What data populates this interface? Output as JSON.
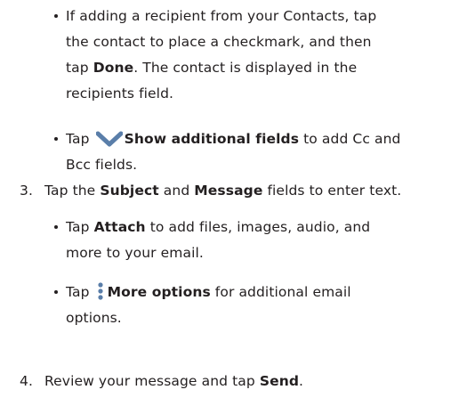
{
  "bullets_top": [
    {
      "parts": [
        {
          "t": "If adding a recipient from your Contacts, tap",
          "b": false,
          "br": true
        },
        {
          "t": "the contact to place a checkmark, and then",
          "b": false,
          "br": true
        },
        {
          "t": "tap ",
          "b": false
        },
        {
          "t": "Done",
          "b": true
        },
        {
          "t": ". The contact is displayed in the",
          "b": false,
          "br": true
        },
        {
          "t": "recipients field.",
          "b": false
        }
      ]
    }
  ],
  "show_fields": {
    "before": "Tap ",
    "icon": "chevron-down-icon",
    "bold": "Show additional fields",
    "after": " to add Cc and",
    "line2": "Bcc fields."
  },
  "step3": {
    "num": "3.",
    "text1": "Tap the ",
    "subject": "Subject",
    "and": " and ",
    "message": "Message",
    "text2": " fields to enter text."
  },
  "attach": {
    "before": "Tap ",
    "bold": "Attach",
    "after": " to add files, images, audio, and",
    "line2": "more to your email."
  },
  "more_options": {
    "before": "Tap ",
    "icon": "more-options-icon",
    "bold": "More options",
    "after": " for additional email",
    "line2": "options."
  },
  "step4": {
    "num": "4.",
    "text": "Review your message and tap ",
    "bold": "Send",
    "end": "."
  },
  "colors": {
    "text": "#231f20",
    "icon": "#5a7ea9"
  }
}
